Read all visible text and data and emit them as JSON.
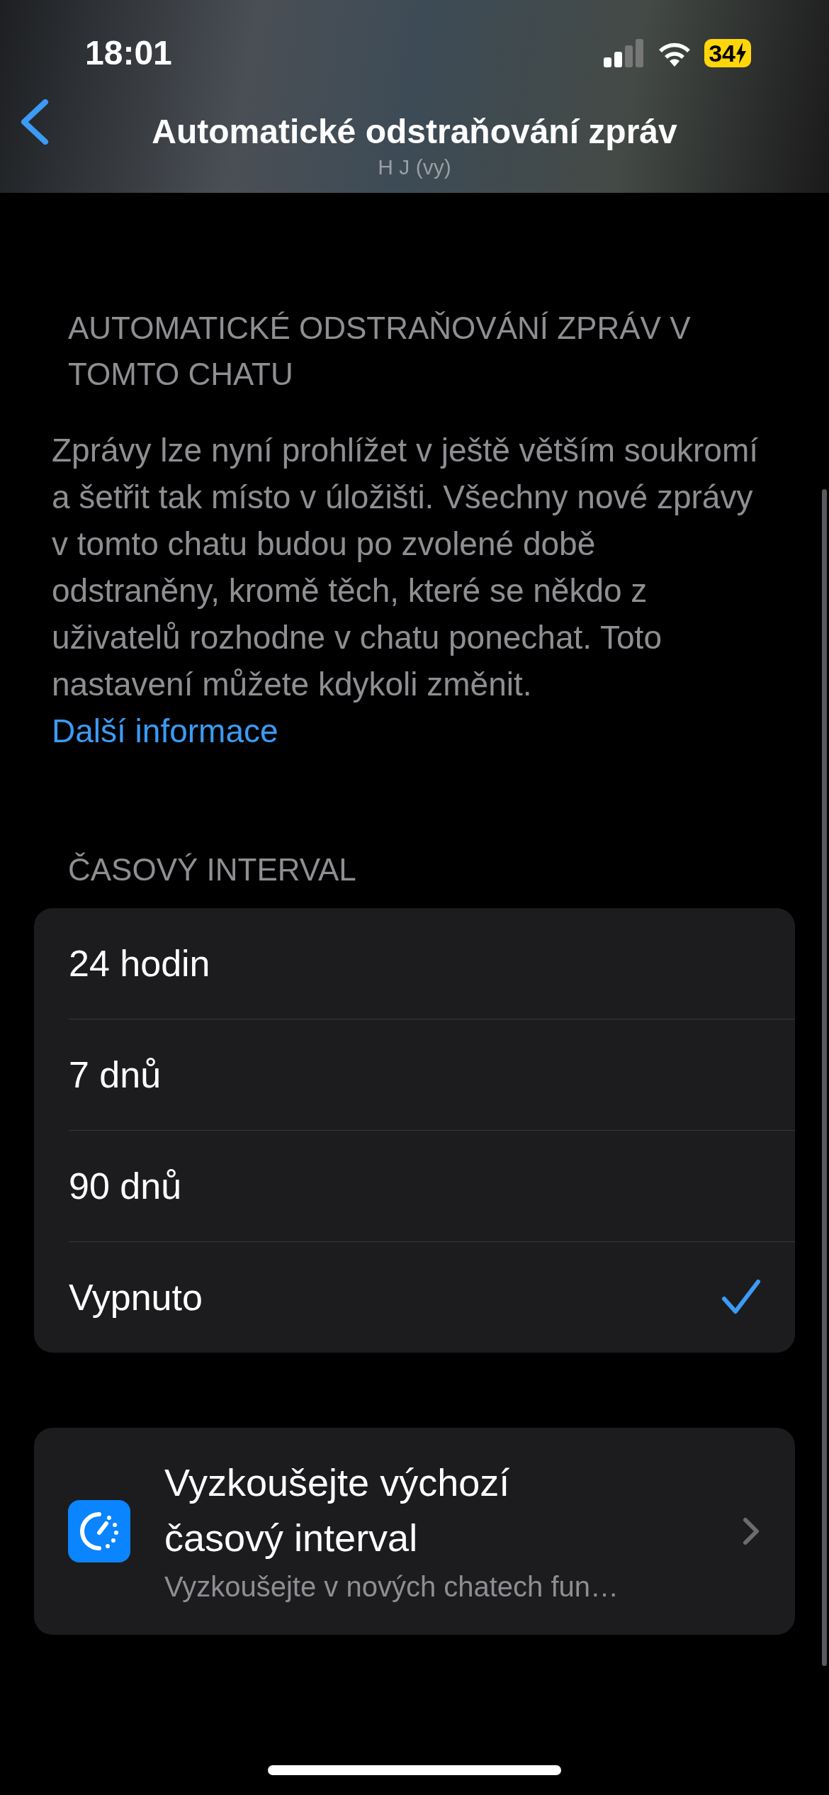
{
  "status_bar": {
    "time": "18:01",
    "battery": "34"
  },
  "nav": {
    "title": "Automatické odstraňování zpráv",
    "subtitle": "H J (vy)"
  },
  "section_header": "AUTOMATICKÉ ODSTRAŇOVÁNÍ ZPRÁV V TOMTO CHATU",
  "description": {
    "text": "Zprávy lze nyní prohlížet v ještě větším soukromí a šetřit tak místo v úložišti. Všechny nové zprávy v tomto chatu budou po zvolené době odstraněny, kromě těch, které se někdo z uživatelů rozhodne v chatu ponechat. Toto nastavení můžete kdykoli změnit.",
    "link": "Další informace"
  },
  "interval_header": "ČASOVÝ INTERVAL",
  "options": [
    {
      "label": "24 hodin",
      "selected": false
    },
    {
      "label": "7 dnů",
      "selected": false
    },
    {
      "label": "90 dnů",
      "selected": false
    },
    {
      "label": "Vypnuto",
      "selected": true
    }
  ],
  "promo": {
    "title": "Vyzkoušejte výchozí časový interval",
    "subtitle": "Vyzkoušejte v nových chatech fun…"
  }
}
